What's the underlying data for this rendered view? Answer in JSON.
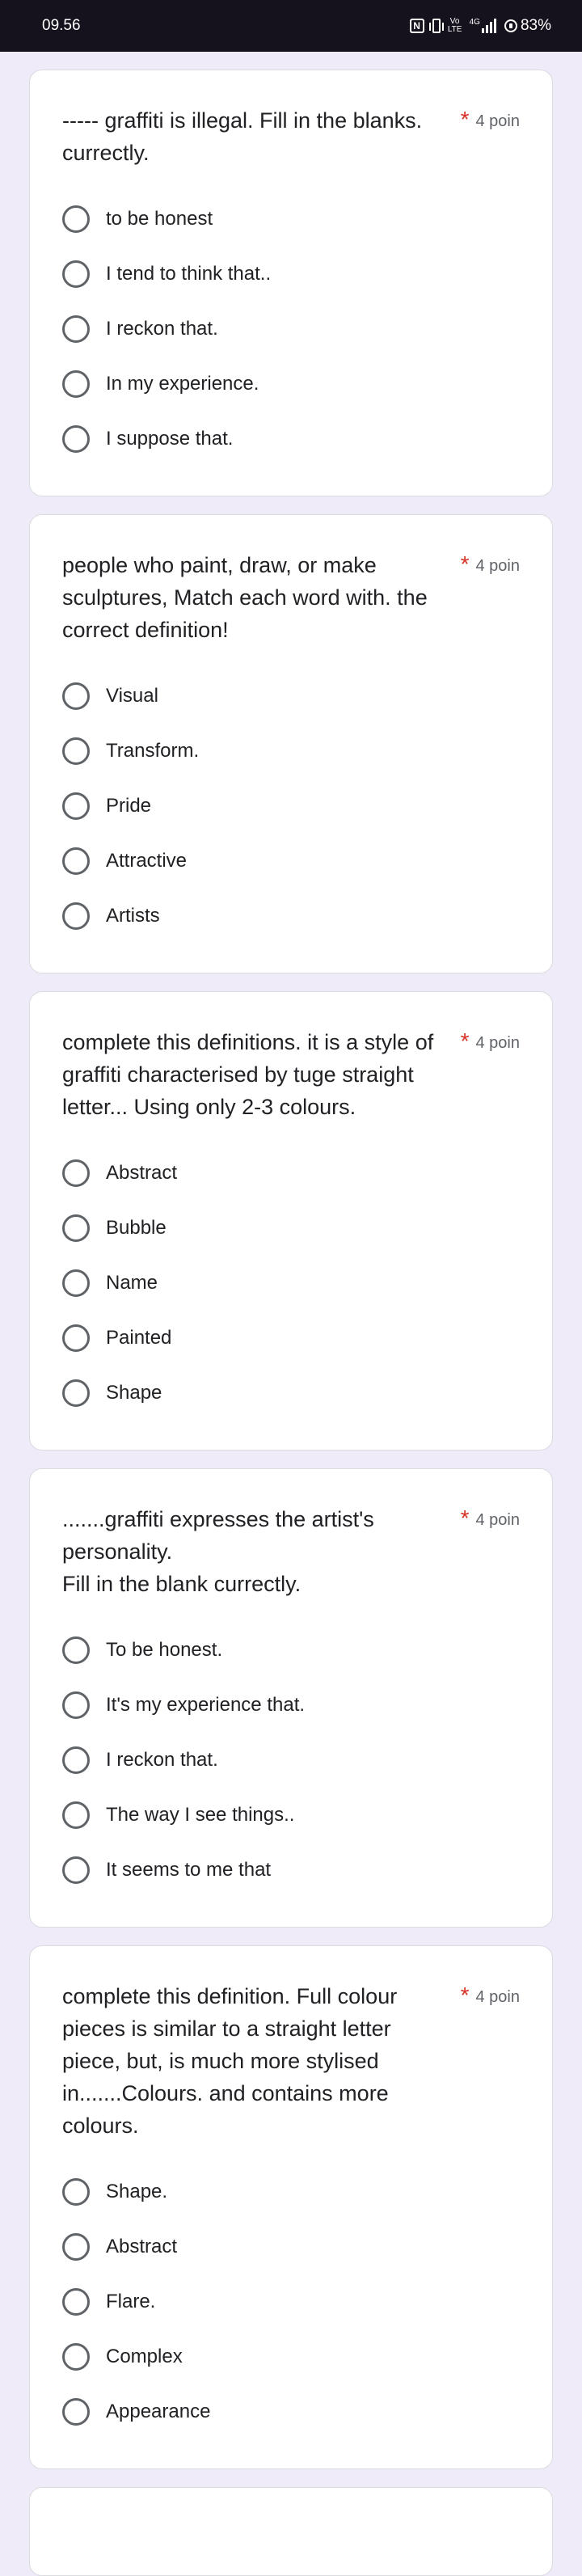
{
  "status_bar": {
    "time": "09.56",
    "nfc": "N",
    "volte": "Vo LTE",
    "network": "4G",
    "battery": "83%"
  },
  "questions": [
    {
      "title": "----- graffiti is illegal. Fill in the blanks.\ncurrectly.",
      "required": "*",
      "points": "4 poin",
      "options": [
        "to be honest",
        "I tend to think that..",
        "I reckon that.",
        "In my experience.",
        "I suppose that."
      ]
    },
    {
      "title": "people who paint, draw, or make sculptures, Match each word with. the correct definition!",
      "required": "*",
      "points": "4 poin",
      "options": [
        "Visual",
        "Transform.",
        "Pride",
        "Attractive",
        "Artists"
      ]
    },
    {
      "title": "complete this definitions. it is a style of graffiti characterised by tuge straight letter... Using only 2-3 colours.",
      "required": "*",
      "points": "4 poin",
      "options": [
        "Abstract",
        "Bubble",
        "Name",
        "Painted",
        "Shape"
      ]
    },
    {
      "title": ".......graffiti expresses the artist's personality.\nFill in the blank currectly.",
      "required": "*",
      "points": "4 poin",
      "options": [
        "To be honest.",
        "It's my experience that.",
        "I reckon that.",
        "The way I see things..",
        "It seems to me that"
      ]
    },
    {
      "title": "complete this definition. Full colour pieces is similar to a straight letter piece, but, is much more stylised in.......Colours. and contains more colours.",
      "required": "*",
      "points": "4 poin",
      "options": [
        "Shape.",
        "Abstract",
        "Flare.",
        "Complex",
        "Appearance"
      ]
    }
  ],
  "colors": {
    "background": "#efebf8",
    "status_bar": "#16121d",
    "required": "#d93025"
  }
}
